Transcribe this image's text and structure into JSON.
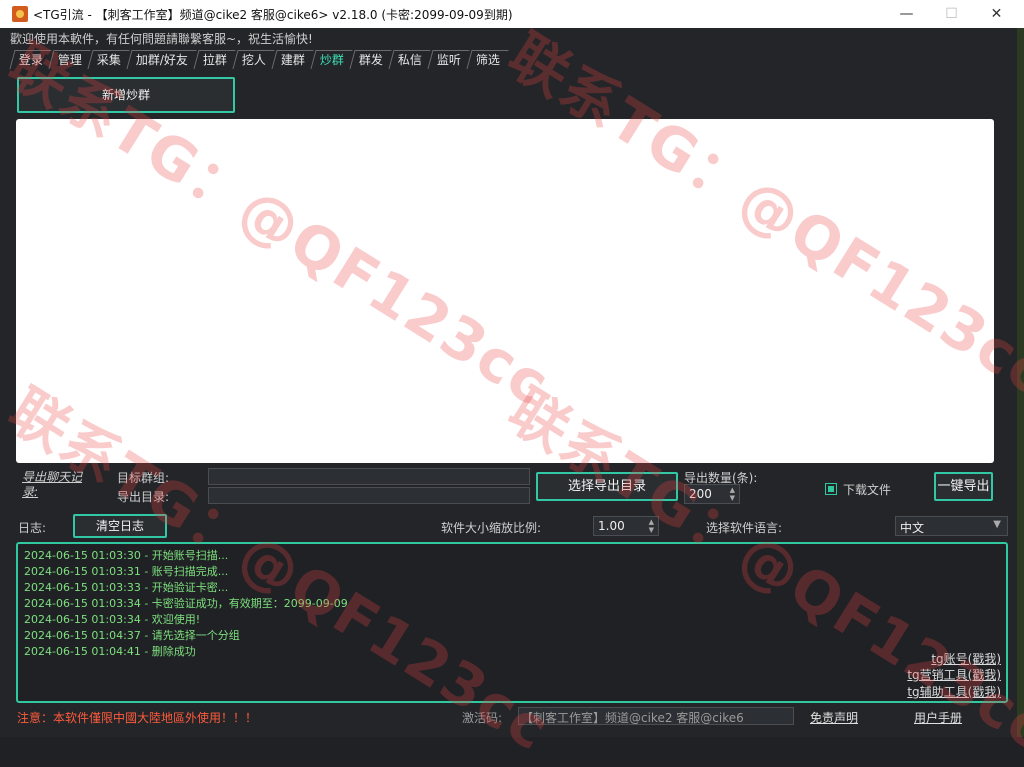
{
  "window": {
    "title": "<TG引流 - 【刺客工作室】频道@cike2 客服@cike6> v2.18.0 (卡密:2099-09-09到期)",
    "min": "—",
    "max": "☐",
    "close": "✕"
  },
  "welcome": "歡迎使用本軟件，有任何問題請聯繫客服~，祝生活愉快!",
  "tabs": [
    "登录",
    "管理",
    "采集",
    "加群/好友",
    "拉群",
    "挖人",
    "建群",
    "炒群",
    "群发",
    "私信",
    "监听",
    "筛选"
  ],
  "active_tab": "炒群",
  "add_group_button": "新增炒群",
  "export": {
    "section_label": "导出聊天记录:",
    "target_group_label": "目标群组:",
    "target_group_value": "",
    "export_dir_label": "导出目录:",
    "export_dir_value": "",
    "choose_dir_button": "选择导出目录",
    "count_label": "导出数量(条):",
    "count_value": "200",
    "download_files_label": "下载文件",
    "download_files_checked": true,
    "one_click_export_button": "一键导出"
  },
  "log": {
    "label": "日志:",
    "clear_button": "清空日志",
    "scale_label": "软件大小缩放比例:",
    "scale_value": "1.00",
    "lang_label": "选择软件语言:",
    "lang_value": "中文",
    "lines": [
      "2024-06-15 01:03:30 - 开始账号扫描...",
      "2024-06-15 01:03:31 - 账号扫描完成...",
      "2024-06-15 01:03:33 - 开始验证卡密...",
      "2024-06-15 01:03:34 - 卡密验证成功，有效期至：2099-09-09",
      "2024-06-15 01:03:34 - 欢迎使用!",
      "2024-06-15 01:04:37 - 请先选择一个分组",
      "2024-06-15 01:04:41 - 删除成功"
    ],
    "links": [
      "tg账号(戳我)",
      "tg营销工具(戳我)",
      "tg辅助工具(戳我)"
    ]
  },
  "footer": {
    "warning": "注意：本软件僅限中國大陸地區外使用！！！",
    "activation_label": "激活码:",
    "activation_value": "【刺客工作室】频道@cike2 客服@cike6",
    "disclaimer": "免责声明",
    "manual": "用户手册"
  },
  "watermark": "联系TG：@QF123cc",
  "colors": {
    "accent": "#2fc89f",
    "active_tab": "#3ee0b8",
    "log_text": "#7ee07e",
    "warning": "#ff5a3c"
  }
}
